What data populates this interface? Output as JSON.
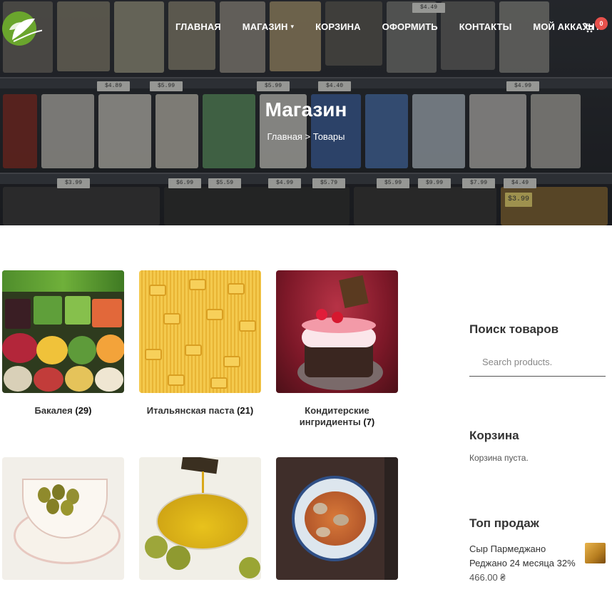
{
  "nav": {
    "items": [
      "ГЛАВНАЯ",
      "МАГАЗИН",
      "КОРЗИНА",
      "ОФОРМИТЬ",
      "КОНТАКТЫ",
      "МОЙ АККАУНТ"
    ],
    "cart_count": "0"
  },
  "hero": {
    "title": "Магазин",
    "breadcrumb": "Главная > Товары",
    "price_tags": [
      "$4.49",
      "$4.89",
      "$5.99",
      "$5.99",
      "$4.40",
      "$4.99",
      "$3.99",
      "$6.99",
      "$5.59",
      "$4.99",
      "$5.79",
      "$5.99",
      "$9.99",
      "$7.99",
      "$4.49",
      "$3.99"
    ]
  },
  "categories": [
    {
      "name": "Бакалея",
      "count": "(29)"
    },
    {
      "name": "Итальянская паста",
      "count": "(21)"
    },
    {
      "name": "Кондитерские ингридиенты",
      "count": "(7)"
    }
  ],
  "sidebar": {
    "search_title": "Поиск товаров",
    "search_placeholder": "Search products.",
    "cart_title": "Корзина",
    "cart_empty": "Корзина пуста.",
    "top_title": "Топ продаж",
    "top_item": {
      "name": "Сыр Пармеджано Реджано 24 месяца 32%",
      "price": "466.00 ₴"
    }
  }
}
